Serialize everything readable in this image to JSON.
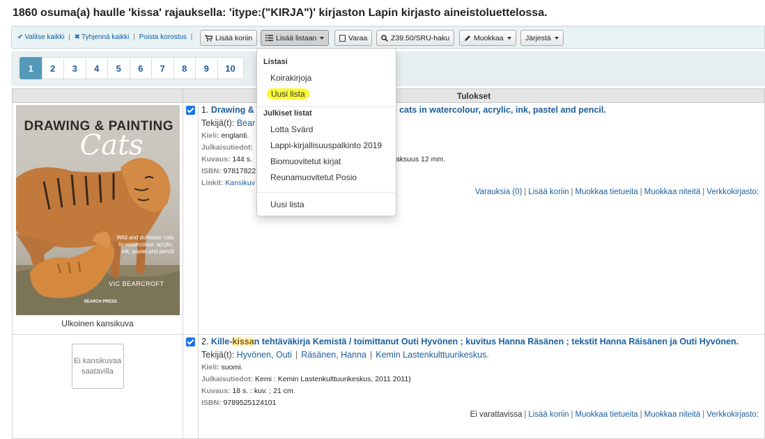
{
  "heading": "1860 osuma(a) haulle 'kissa' rajauksella: 'itype:(\"KIRJA\")' kirjaston Lapin kirjasto aineistoluettelossa.",
  "selection": {
    "select_all": "Valitse kaikki",
    "clear_all": "Tyhjennä kaikki",
    "remove_highlight": "Poista korostus",
    "sep": "|"
  },
  "toolbar": {
    "add_to_cart": "Lisää koriin",
    "add_to_list": "Lisää listaan",
    "hold": "Varaa",
    "z3950": "Z39.50/SRU-haku",
    "edit": "Muokkaa",
    "sort": "Järjestä"
  },
  "pagination": [
    "1",
    "2",
    "3",
    "4",
    "5",
    "6",
    "7",
    "8",
    "9",
    "10"
  ],
  "pagination_current": "1",
  "results_header": "Tulokset",
  "dropdown": {
    "my_lists_header": "Listasi",
    "my_lists": [
      "Koirakirjoja",
      "Uusi lista"
    ],
    "public_lists_header": "Julkiset listat",
    "public_lists": [
      "Lotta Svärd",
      "Lappi-kirjallisuuspalkinto 2019",
      "Biomuovitetut kirjat",
      "Reunamuovitetut Posio"
    ],
    "new_list": "Uusi lista",
    "highlight_color": "#fbf935"
  },
  "records": [
    {
      "number": "1.",
      "title_visible_start": "Drawing &",
      "title_visible_end": "c cats in watercolour, acrylic, ink, pastel and pencil.",
      "author_label": "Tekijä(t):",
      "author_visible": "Bear",
      "fields": [
        {
          "label": "Kieli:",
          "value": "englanti."
        },
        {
          "label": "Julkaisutiedot:",
          "value": ""
        },
        {
          "label": "Kuvaus:",
          "value": "144 s.",
          "value_tail": "paksuus 12 mm."
        },
        {
          "label": "ISBN:",
          "value": "97817822"
        },
        {
          "label": "Linkit:",
          "value": "Kansikuv"
        }
      ],
      "actions": [
        "Varauksia (0)",
        "Lisää koriin",
        "Muokkaa tietueita",
        "Muokkaa niteitä",
        "Verkkokirjasto:"
      ],
      "cover": {
        "title": "DRAWING & PAINTING",
        "script": "Cats",
        "blurb": "Wild and domestic cats in watercolour, acrylic, ink, pastel and pencil",
        "author": "VIC BEARCROFT",
        "publisher": "SEARCH PRESS",
        "caption": "Ulkoinen kansikuva"
      }
    },
    {
      "number": "2.",
      "title_pre": "Kille-",
      "title_hl": "kissa",
      "title_post": "n tehtäväkirja Kemistä / toimittanut Outi Hyvönen ; kuvitus Hanna Räsänen ; tekstit Hanna Räisänen ja Outi Hyvönen.",
      "author_label": "Tekijä(t):",
      "authors": [
        "Hyvönen, Outi",
        "Räsänen, Hanna",
        "Kemin Lastenkulttuurikeskus."
      ],
      "fields": [
        {
          "label": "Kieli:",
          "value": "suomi."
        },
        {
          "label": "Julkaisutiedot:",
          "value": "Kemi : Kemin Lastenkulttuurikeskus, 2011 2011)"
        },
        {
          "label": "Kuvaus:",
          "value": "18 s. : kuv. ; 21 cm."
        },
        {
          "label": "ISBN:",
          "value": "9789525124101"
        }
      ],
      "actions": [
        "Ei varattavissa",
        "Lisää koriin",
        "Muokkaa tietueita",
        "Muokkaa niteitä",
        "Verkkokirjasto:"
      ],
      "no_cover": "Ei kansikuvaa saatavilla"
    }
  ]
}
